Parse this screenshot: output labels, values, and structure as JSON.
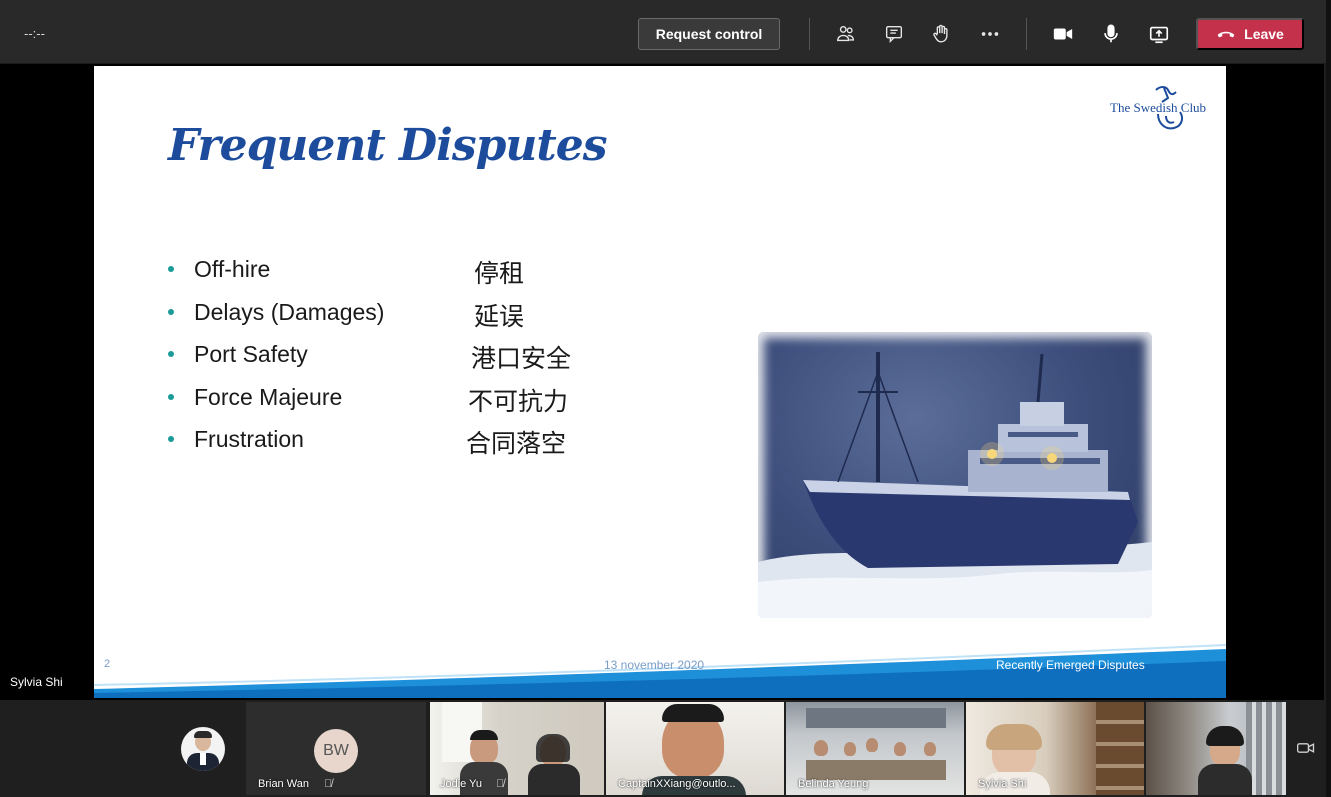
{
  "topbar": {
    "timer": "--:--",
    "request_control_label": "Request control",
    "leave_label": "Leave",
    "icons": [
      "people-icon",
      "chat-icon",
      "raise-hand-icon",
      "more-options-icon",
      "camera-icon",
      "microphone-icon",
      "share-screen-icon"
    ]
  },
  "slide": {
    "title": "Frequent Disputes",
    "logo_text": "The Swedish Club",
    "bullets": [
      {
        "en": "Off-hire",
        "zh": "停租"
      },
      {
        "en": "Delays (Damages)",
        "zh": "延误"
      },
      {
        "en": "Port Safety",
        "zh": "港口安全"
      },
      {
        "en": "Force Majeure",
        "zh": "不可抗力"
      },
      {
        "en": "Frustration",
        "zh": "合同落空"
      }
    ],
    "footer_number": "2",
    "footer_date": "13 november 2020",
    "footer_right": "Recently Emerged Disputes",
    "colors": {
      "title": "#1d4c9c",
      "bullet": "#1b9a9a",
      "footer_wave": "#1e8fd9"
    }
  },
  "presenter_name": "Sylvia Shi",
  "participants": [
    {
      "name": "",
      "initials": ""
    },
    {
      "name": "Brian Wan",
      "initials": "BW"
    },
    {
      "name": "Jodie Yu"
    },
    {
      "name": "CaptainXXiang@outlo..."
    },
    {
      "name": "Belinda Yeung"
    },
    {
      "name": "Sylvia Shi"
    },
    {
      "name": ""
    }
  ]
}
